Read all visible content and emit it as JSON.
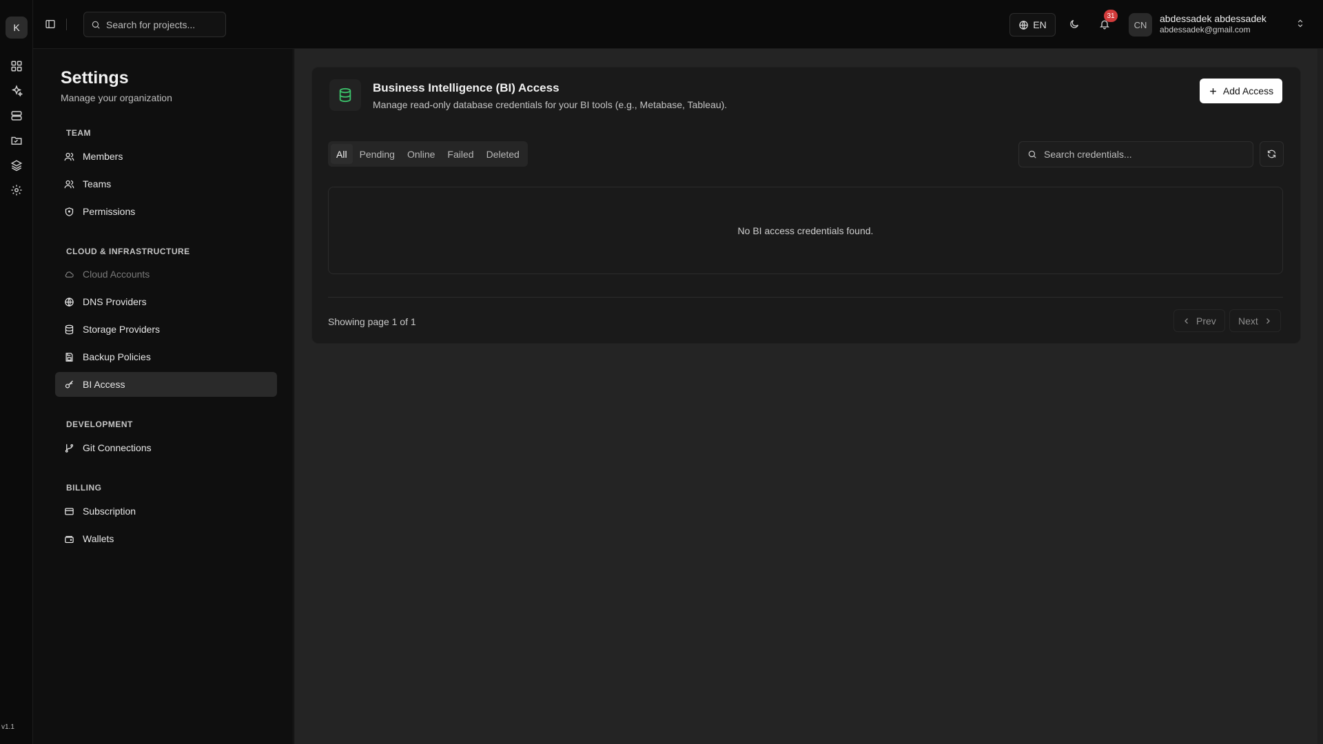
{
  "rail": {
    "logo_letter": "K",
    "icons": [
      "dashboard-icon",
      "sparkles-icon",
      "server-icon",
      "folder-icon",
      "layers-icon",
      "settings-icon"
    ],
    "version": "v1.1"
  },
  "topbar": {
    "search_placeholder": "Search for projects...",
    "language": "EN",
    "notification_count": "31",
    "avatar_initials": "CN",
    "user_name": "abdessadek abdessadek",
    "user_email": "abdessadek@gmail.com"
  },
  "settings": {
    "title": "Settings",
    "subtitle": "Manage your organization",
    "sections": {
      "team": {
        "title": "TEAM",
        "items": [
          {
            "label": "Members",
            "icon": "users-icon"
          },
          {
            "label": "Teams",
            "icon": "users-icon"
          },
          {
            "label": "Permissions",
            "icon": "shield-icon"
          }
        ]
      },
      "cloud": {
        "title": "CLOUD & INFRASTRUCTURE",
        "items": [
          {
            "label": "Cloud Accounts",
            "icon": "cloud-icon",
            "disabled": true
          },
          {
            "label": "DNS Providers",
            "icon": "globe-icon"
          },
          {
            "label": "Storage Providers",
            "icon": "database-icon"
          },
          {
            "label": "Backup Policies",
            "icon": "save-icon"
          },
          {
            "label": "BI Access",
            "icon": "key-icon",
            "active": true
          }
        ]
      },
      "development": {
        "title": "DEVELOPMENT",
        "items": [
          {
            "label": "Git Connections",
            "icon": "git-branch-icon"
          }
        ]
      },
      "billing": {
        "title": "BILLING",
        "items": [
          {
            "label": "Subscription",
            "icon": "credit-card-icon"
          },
          {
            "label": "Wallets",
            "icon": "wallet-icon"
          }
        ]
      }
    }
  },
  "main": {
    "title": "Business Intelligence (BI) Access",
    "description": "Manage read-only database credentials for your BI tools (e.g., Metabase, Tableau).",
    "add_button": "Add Access",
    "tabs": [
      "All",
      "Pending",
      "Online",
      "Failed",
      "Deleted"
    ],
    "active_tab": "All",
    "search_placeholder": "Search credentials...",
    "empty_message": "No BI access credentials found.",
    "pagination": {
      "info": "Showing page 1 of 1",
      "prev": "Prev",
      "next": "Next"
    }
  },
  "colors": {
    "accent_green": "#3cc36b",
    "badge_red": "#d23b3b"
  }
}
